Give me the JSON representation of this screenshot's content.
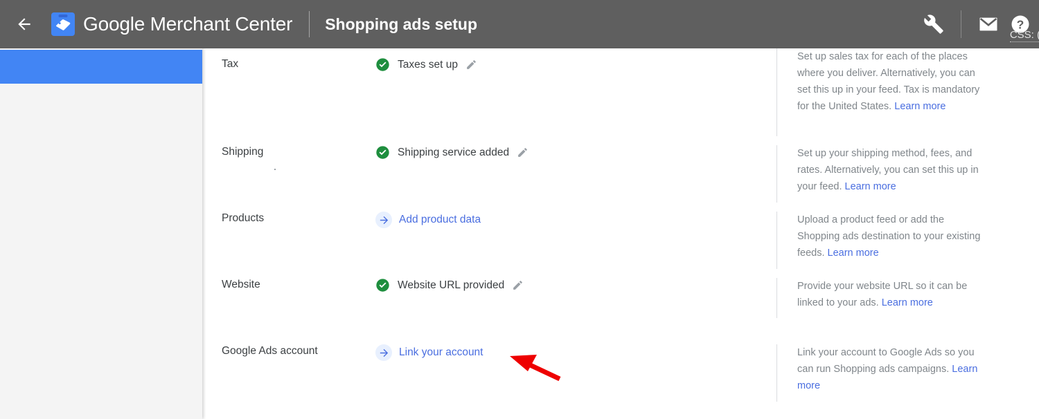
{
  "topbar": {
    "back_icon": "arrow-left-icon",
    "logo_icon": "merchant-center-tag-logo",
    "brand_google": "Google",
    "brand_rest": " Merchant Center",
    "page_title": "Shopping ads setup",
    "tools_icon": "wrench-icon",
    "mail_icon": "envelope-icon",
    "help_icon": "question-mark-icon",
    "css_label": "CSS: (",
    "background_color": "#5f5f5f"
  },
  "sidebar": {
    "selected_color": "#4285f4",
    "background_color": "#f4f4f4"
  },
  "colors": {
    "accent_blue": "#4285f4",
    "link_blue": "#4a6ee0",
    "success_green": "#1e8e3e",
    "annotation_red": "#ee0000",
    "text_primary": "#3c4043",
    "text_secondary": "#80868b"
  },
  "setup_rows": [
    {
      "label": "Tax",
      "status_type": "complete",
      "status_icon": "green-check-circle-icon",
      "status_text": "Taxes set up",
      "has_edit": true,
      "edit_icon": "pencil-icon",
      "help_text": "Set up sales tax for each of the places where you deliver. Alternatively, you can set this up in your feed. Tax is mandatory for the United States. ",
      "help_link": "Learn more"
    },
    {
      "label": "Shipping",
      "status_type": "complete",
      "status_icon": "green-check-circle-icon",
      "status_text": "Shipping service added",
      "has_edit": true,
      "edit_icon": "pencil-icon",
      "help_text": "Set up your shipping method, fees, and rates. Alternatively, you can set this up in your feed. ",
      "help_link": "Learn more"
    },
    {
      "label": "Products",
      "status_type": "action",
      "status_icon": "blue-arrow-right-circle-icon",
      "status_text": "Add product data",
      "has_edit": false,
      "edit_icon": "",
      "help_text": "Upload a product feed or add the Shopping ads destination to your existing feeds. ",
      "help_link": "Learn more"
    },
    {
      "label": "Website",
      "status_type": "complete",
      "status_icon": "green-check-circle-icon",
      "status_text": "Website URL provided",
      "has_edit": true,
      "edit_icon": "pencil-icon",
      "help_text": "Provide your website URL so it can be linked to your ads. ",
      "help_link": "Learn more"
    },
    {
      "label": "Google Ads account",
      "status_type": "action",
      "status_icon": "blue-arrow-right-circle-icon",
      "status_text": "Link your account",
      "has_edit": false,
      "edit_icon": "",
      "help_text": "Link your account to Google Ads so you can run Shopping ads campaigns. ",
      "help_link": "Learn more"
    }
  ],
  "annotation": {
    "type": "red-arrow",
    "points_to": "Link your account",
    "color": "#ee0000"
  }
}
